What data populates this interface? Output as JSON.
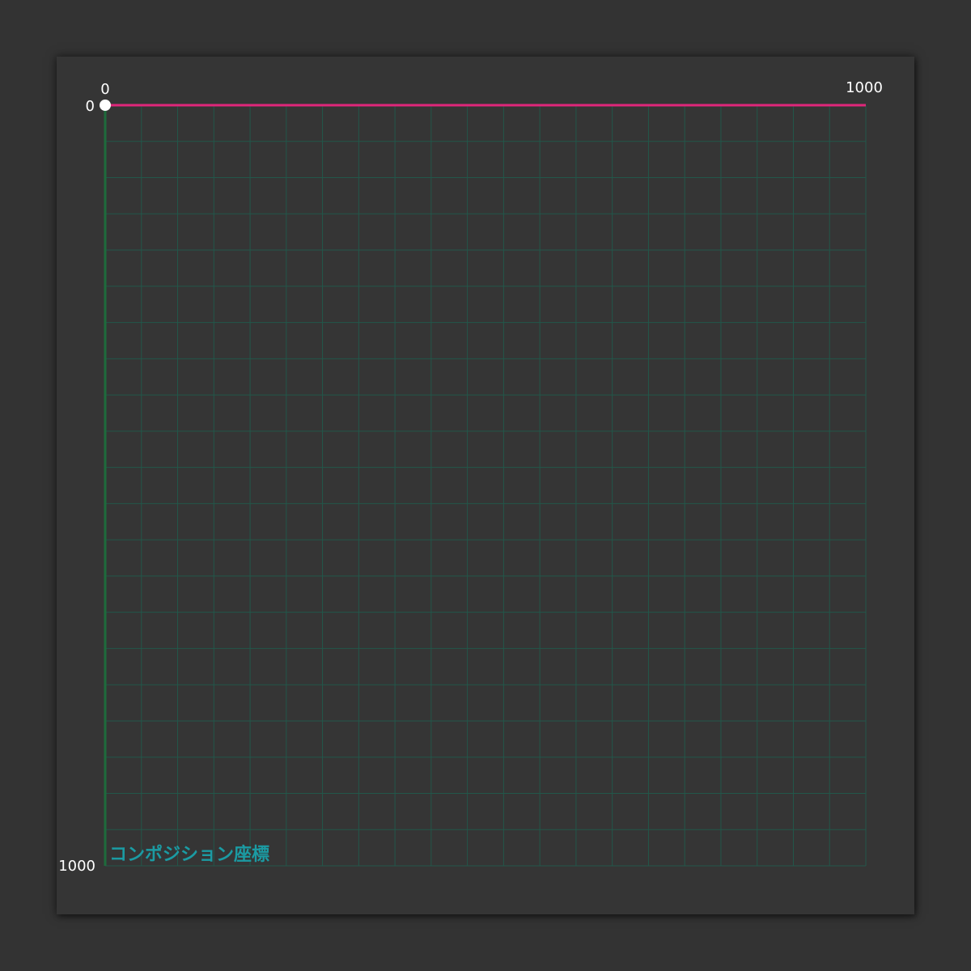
{
  "caption": "コンポジション座標",
  "axes": {
    "x": {
      "min": 0,
      "max": 1000,
      "tick_labels": [
        "0",
        "1000"
      ]
    },
    "y": {
      "min": 0,
      "max": 1000,
      "tick_labels": [
        "0",
        "1000"
      ]
    },
    "x_axis_color": "#e0267a",
    "y_axis_color": "#1e6b3c"
  },
  "grid": {
    "divisions": 21,
    "color": "#22574a"
  },
  "origin": {
    "x": 0,
    "y": 0,
    "color": "#ffffff"
  },
  "colors": {
    "background": "#333333",
    "panel": "#353535",
    "label": "#ffffff",
    "caption": "#1b9ba3"
  }
}
